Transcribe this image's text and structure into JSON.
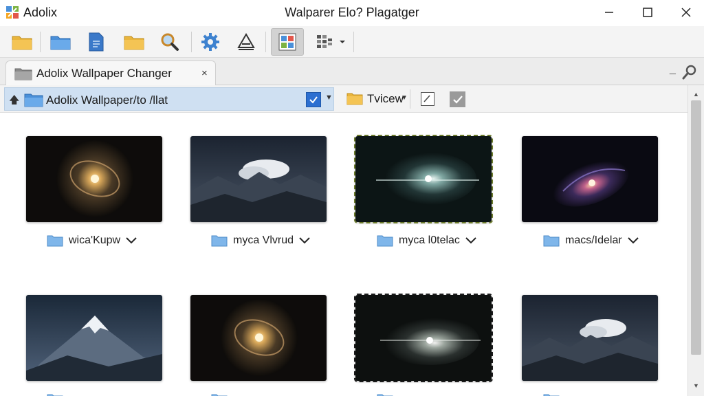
{
  "window": {
    "app_name": "Adolix",
    "title": "Walparer Elo? Plagatger"
  },
  "tab": {
    "label": "Adolix Wallpaper Changer",
    "close_glyph": "×"
  },
  "pathbar": {
    "path": "Adolix Wallpaper/to /llat",
    "view_label": "Tvicew"
  },
  "toolbar": {
    "icons": [
      "folder-icon",
      "folder-icon",
      "document-icon",
      "folder-icon",
      "search-icon",
      "settings-gear-icon",
      "upload-icon",
      "image-tile-icon",
      "view-options-icon"
    ]
  },
  "thumbnails": [
    {
      "caption": "wica'Kupw",
      "image": "spiral-galaxy"
    },
    {
      "caption": "myca Vlvrud",
      "image": "mountain-clouds-night"
    },
    {
      "caption": "myca l0telac",
      "image": "nebula-green"
    },
    {
      "caption": "macs/Idelar",
      "image": "purple-galaxy"
    },
    {
      "caption": "",
      "image": "snowy-peak"
    },
    {
      "caption": "",
      "image": "spiral-galaxy"
    },
    {
      "caption": "",
      "image": "nebula-grey"
    },
    {
      "caption": "",
      "image": "mountain-clouds-night"
    }
  ],
  "colors": {
    "path_highlight": "#cfe0f2",
    "folder": "#7fb6ea",
    "accent": "#2c6fd1"
  }
}
